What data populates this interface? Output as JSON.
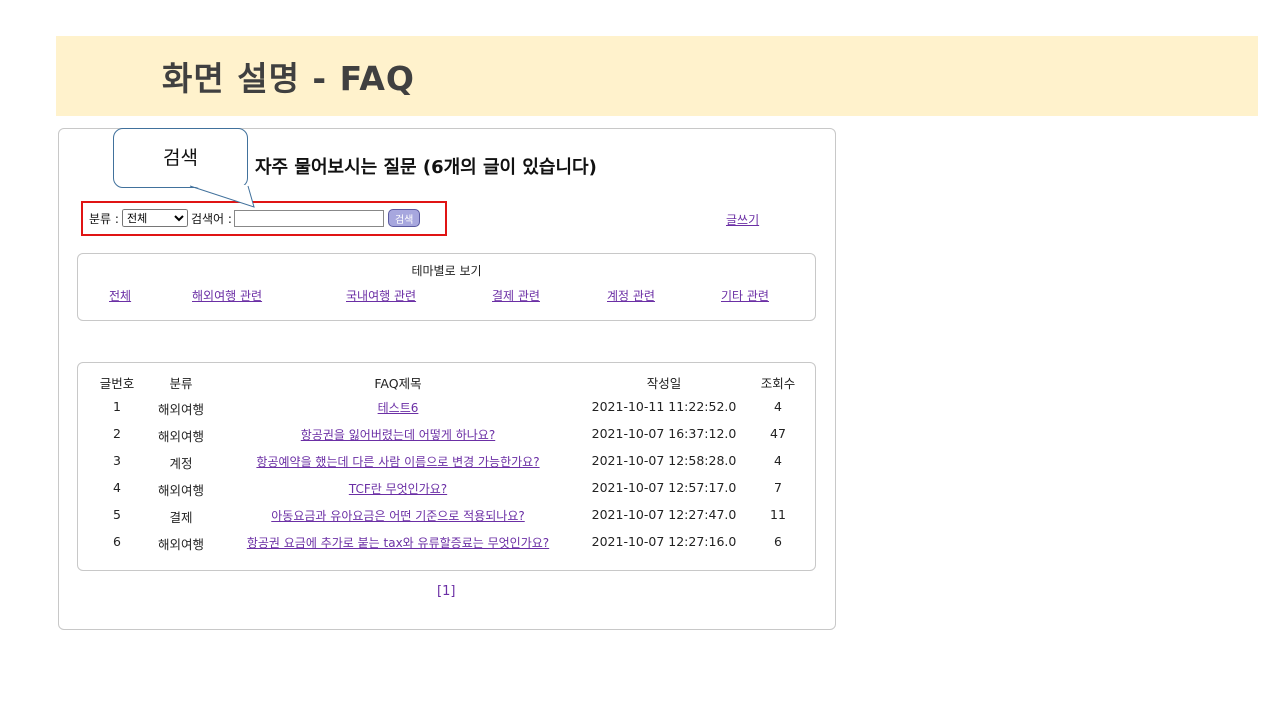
{
  "slide": {
    "title": "화면 설명 - FAQ"
  },
  "callout": {
    "label": "검색"
  },
  "page": {
    "heading": "자주 물어보시는 질문 (6개의 글이 있습니다)"
  },
  "search": {
    "category_label": "분류 :",
    "category_selected": "전체",
    "keyword_label": "검색어 :",
    "keyword_value": "",
    "button_label": "검색"
  },
  "write_link": "글쓰기",
  "theme": {
    "title": "테마별로 보기",
    "links": [
      "전체",
      "해외여행 관련",
      "국내여행 관련",
      "결제 관련",
      "계정 관련",
      "기타 관련"
    ]
  },
  "table": {
    "headers": [
      "글번호",
      "분류",
      "FAQ제목",
      "작성일",
      "조회수"
    ],
    "rows": [
      {
        "no": "1",
        "category": "해외여행",
        "title": "테스트6",
        "date": "2021-10-11 11:22:52.0",
        "views": "4"
      },
      {
        "no": "2",
        "category": "해외여행",
        "title": "항공권을 잃어버렸는데 어떻게 하나요?",
        "date": "2021-10-07 16:37:12.0",
        "views": "47"
      },
      {
        "no": "3",
        "category": "계정",
        "title": "항공예약을 했는데 다른 사람 이름으로 변경 가능한가요?",
        "date": "2021-10-07 12:58:28.0",
        "views": "4"
      },
      {
        "no": "4",
        "category": "해외여행",
        "title": "TCF란 무엇인가요?",
        "date": "2021-10-07 12:57:17.0",
        "views": "7"
      },
      {
        "no": "5",
        "category": "결제",
        "title": "아동요금과 유아요금은 어떤 기준으로 적용되나요?",
        "date": "2021-10-07 12:27:47.0",
        "views": "11"
      },
      {
        "no": "6",
        "category": "해외여행",
        "title": "항공권 요금에 추가로 붙는 tax와 유류할증료는 무엇인가요?",
        "date": "2021-10-07 12:27:16.0",
        "views": "6"
      }
    ]
  },
  "pager": {
    "label": "[1]"
  },
  "colors": {
    "banner": "#fff2cc",
    "highlight": "#e01414",
    "link": "#6b2fa5",
    "callout_border": "#41719c"
  }
}
